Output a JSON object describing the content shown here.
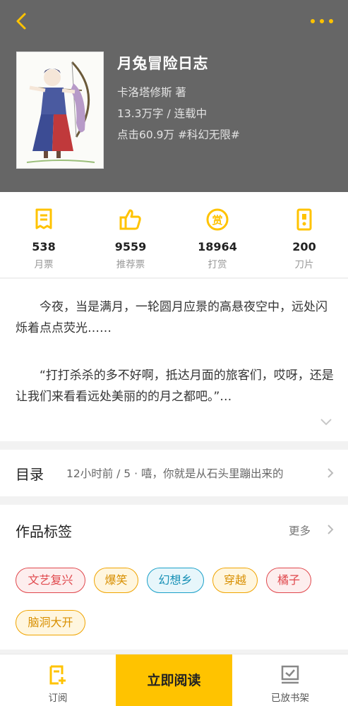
{
  "header": {
    "title": "月兔冒险日志",
    "author": "卡洛塔修斯  著",
    "word_count": "13.3万字 / 连载中",
    "clicks": "点击60.9万  #科幻无限#"
  },
  "stats": [
    {
      "icon": "ticket-icon",
      "value": "538",
      "label": "月票"
    },
    {
      "icon": "thumbs-up-icon",
      "value": "9559",
      "label": "推荐票"
    },
    {
      "icon": "reward-coin-icon",
      "value": "18964",
      "label": "打赏"
    },
    {
      "icon": "blade-icon",
      "value": "200",
      "label": "刀片"
    }
  ],
  "synopsis": {
    "p1": "今夜，当是满月，一轮圆月应景的高悬夜空中，远处闪烁着点点荧光……",
    "p2": "“打打杀杀的多不好啊，抵达月面的旅客们，哎呀，还是让我们来看看远处美丽的的月之都吧。”…"
  },
  "catalog": {
    "label": "目录",
    "latest": "12小时前 / 5 · 嘻，你就是从石头里蹦出来的"
  },
  "tags": {
    "heading": "作品标签",
    "more": "更多",
    "items": [
      {
        "label": "文艺复兴",
        "color": "#e0474c"
      },
      {
        "label": "爆笑",
        "color": "#f0a400"
      },
      {
        "label": "幻想乡",
        "color": "#1aa0c8"
      },
      {
        "label": "穿越",
        "color": "#f0a400"
      },
      {
        "label": "橘子",
        "color": "#e0474c"
      },
      {
        "label": "脑洞大开",
        "color": "#f0a400"
      }
    ]
  },
  "bottom_bar": {
    "subscribe": "订阅",
    "read_now": "立即阅读",
    "on_shelf": "已放书架"
  },
  "colors": {
    "accent": "#ffc300",
    "header_bg": "#666666"
  }
}
